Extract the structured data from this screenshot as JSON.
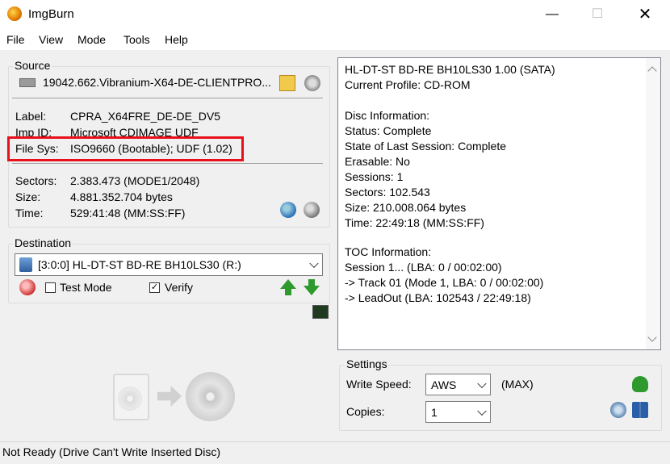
{
  "window": {
    "title": "ImgBurn"
  },
  "menu": [
    "File",
    "View",
    "Mode",
    "Tools",
    "Help"
  ],
  "source": {
    "legend": "Source",
    "path": "19042.662.Vibranium-X64-DE-CLIENTPRO...",
    "label_key": "Label:",
    "label_val": "CPRA_X64FRE_DE-DE_DV5",
    "impid_key": "Imp ID:",
    "impid_val": "Microsoft CDIMAGE UDF",
    "filesys_key": "File Sys:",
    "filesys_val": "ISO9660 (Bootable); UDF (1.02)",
    "sectors_key": "Sectors:",
    "sectors_val": "2.383.473 (MODE1/2048)",
    "size_key": "Size:",
    "size_val": "4.881.352.704 bytes",
    "time_key": "Time:",
    "time_val": "529:41:48 (MM:SS:FF)"
  },
  "destination": {
    "legend": "Destination",
    "drive": "[3:0:0] HL-DT-ST BD-RE  BH10LS30 (R:)",
    "test_mode_label": "Test Mode",
    "test_mode_checked": false,
    "verify_label": "Verify",
    "verify_checked": true
  },
  "info": {
    "lines": [
      "HL-DT-ST BD-RE  BH10LS30 1.00 (SATA)",
      "Current Profile: CD-ROM",
      "",
      "Disc Information:",
      "Status: Complete",
      "State of Last Session: Complete",
      "Erasable: No",
      "Sessions: 1",
      "Sectors: 102.543",
      "Size: 210.008.064 bytes",
      "Time: 22:49:18 (MM:SS:FF)",
      "",
      "TOC Information:",
      "Session 1... (LBA: 0 / 00:02:00)",
      "-> Track 01  (Mode 1, LBA: 0 / 00:02:00)",
      "-> LeadOut  (LBA: 102543 / 22:49:18)"
    ]
  },
  "settings": {
    "legend": "Settings",
    "write_speed_label": "Write Speed:",
    "write_speed_value": "AWS",
    "write_speed_note": "(MAX)",
    "copies_label": "Copies:",
    "copies_value": "1"
  },
  "status": {
    "text": "Not Ready (Drive Can't Write Inserted Disc)"
  },
  "colors": {
    "highlight": "#e8101a",
    "accent_green": "#2e9a2e"
  }
}
